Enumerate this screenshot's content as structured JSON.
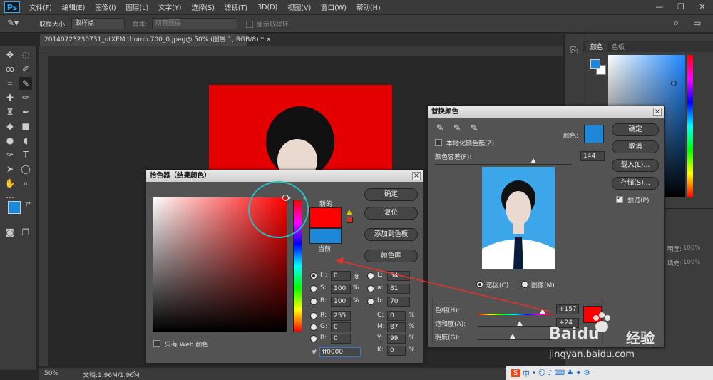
{
  "menubar": {
    "logo": "Ps",
    "items": [
      "文件(F)",
      "编辑(E)",
      "图像(I)",
      "图层(L)",
      "文字(Y)",
      "选择(S)",
      "滤镜(T)",
      "3D(D)",
      "视图(V)",
      "窗口(W)",
      "帮助(H)"
    ]
  },
  "options": {
    "sample_size_label": "取样大小:",
    "sample_size_value": "取样点",
    "sample_label": "样本:",
    "sample_value": "所有图层",
    "show_ring_label": "显示取样环"
  },
  "document": {
    "tab_title": "20140723230731_utXEM.thumb.700_0.jpeg@ 50% (图层 1, RGB/8) *",
    "zoom": "50%",
    "doc_info": "文档:1.96M/1.96M"
  },
  "right_panel": {
    "tab_color": "颜色",
    "tab_swatches": "色板",
    "layers_opacity_label": "明度:",
    "layers_opacity_value": "100%",
    "layers_fill_label": "填充:",
    "layers_fill_value": "100%"
  },
  "picker": {
    "title": "拾色器（结果颜色）",
    "new_label": "新的",
    "current_label": "当前",
    "ok": "确定",
    "reset": "复位",
    "add_swatch": "添加到色板",
    "color_lib": "颜色库",
    "h_label": "H:",
    "h_value": "0",
    "h_unit": "度",
    "s_label": "S:",
    "s_value": "100",
    "s_unit": "%",
    "b_label": "B:",
    "b_value": "100",
    "b_unit": "%",
    "r_label": "R:",
    "r_value": "255",
    "g_label": "G:",
    "g_value": "0",
    "bb_label": "B:",
    "bb_value": "0",
    "l_label": "L:",
    "l_value": "54",
    "a_label": "a:",
    "a_value": "81",
    "lb_label": "b:",
    "lb_value": "70",
    "c_label": "C:",
    "c_value": "0",
    "c_unit": "%",
    "m_label": "M:",
    "m_value": "87",
    "m_unit": "%",
    "y_label": "Y:",
    "y_value": "99",
    "y_unit": "%",
    "k_label": "K:",
    "k_value": "0",
    "k_unit": "%",
    "hash": "#",
    "hex_value": "ff0000",
    "web_only": "只有 Web 颜色",
    "new_color": "#ff0000",
    "current_color": "#1e88d8"
  },
  "replace": {
    "title": "替换颜色",
    "localized": "本地化颜色簇(Z)",
    "color_label": "颜色:",
    "tolerance_label": "颜色容差(F):",
    "tolerance_value": "144",
    "tolerance_level": 0.72,
    "ok": "确定",
    "cancel": "取消",
    "load": "载入(L)...",
    "save": "存储(S)...",
    "preview": "预览(P)",
    "selection": "选区(C)",
    "image": "图像(M)",
    "hue_label": "色相(H):",
    "hue_value": "+157",
    "sat_label": "饱和度(A):",
    "sat_value": "+24",
    "light_label": "明度(G):",
    "sample_color": "#1e88d8",
    "result_color": "#ff0000"
  },
  "watermark": {
    "brand": "Baidu",
    "cn": "经验",
    "url": "jingyan.baidu.com"
  },
  "taskbar": {
    "ime": "中"
  }
}
